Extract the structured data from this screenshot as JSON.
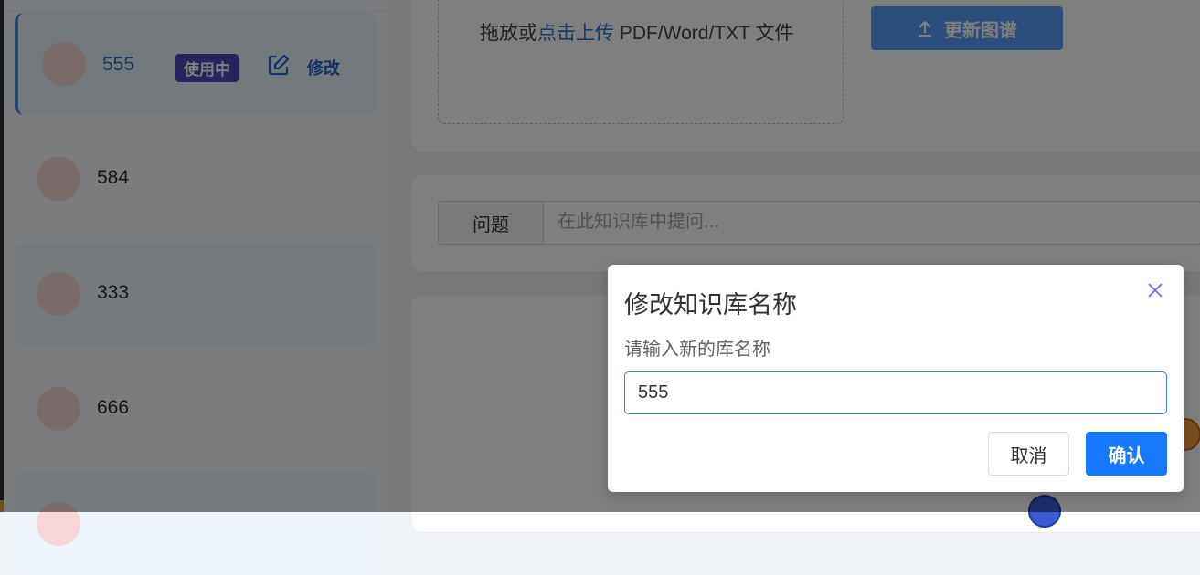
{
  "sidebar": {
    "items": [
      {
        "name": "555",
        "badge": "使用中",
        "edit_label": "修改"
      },
      {
        "name": "584"
      },
      {
        "name": "333"
      },
      {
        "name": "666"
      }
    ]
  },
  "upload": {
    "prefix": "拖放或",
    "link": "点击上传",
    "suffix": " PDF/Word/TXT 文件"
  },
  "update_button": {
    "label": "更新图谱",
    "icon": "upload-icon"
  },
  "question": {
    "label": "问题",
    "placeholder": "在此知识库中提问..."
  },
  "modal": {
    "title": "修改知识库名称",
    "message": "请输入新的库名称",
    "input_value": "555",
    "cancel_label": "取消",
    "confirm_label": "确认",
    "close_icon": "close-icon"
  },
  "colors": {
    "accent": "#1677ff",
    "badge": "#5147b8",
    "link": "#2f74c4"
  }
}
